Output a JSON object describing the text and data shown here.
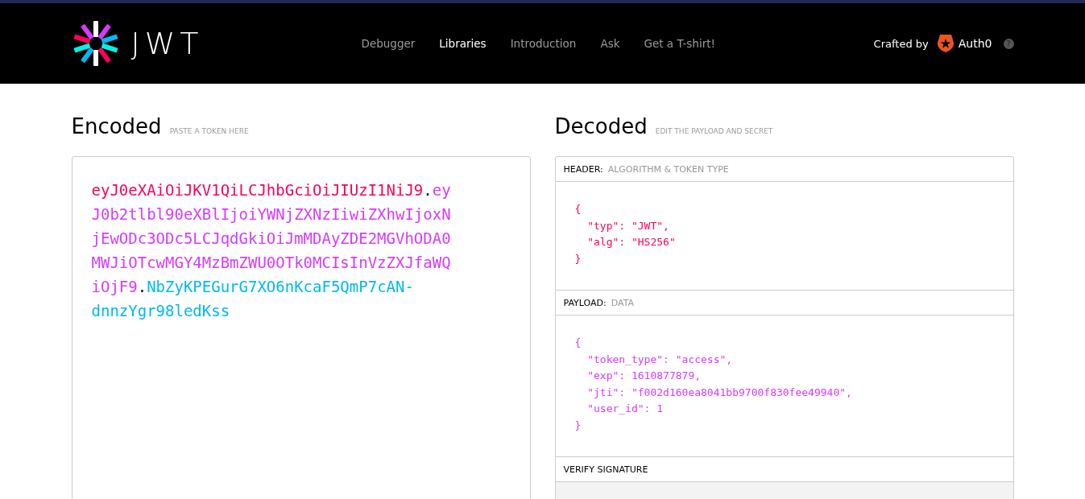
{
  "header": {
    "logo_text": "JWT",
    "nav": [
      {
        "label": "Debugger",
        "selected": false
      },
      {
        "label": "Libraries",
        "selected": true
      },
      {
        "label": "Introduction",
        "selected": false
      },
      {
        "label": "Ask",
        "selected": false
      },
      {
        "label": "Get a T-shirt!",
        "selected": false
      }
    ],
    "crafted_by": "Crafted by",
    "brand": "Auth0",
    "help": "?"
  },
  "encoded": {
    "title": "Encoded",
    "hint": "PASTE A TOKEN HERE",
    "parts": [
      {
        "kind": "header",
        "text": "eyJ0eXAiOiJKV1QiLCJhbGciOiJIUzI1NiJ9",
        "color": "#fb015b"
      },
      {
        "kind": "separator",
        "text": "."
      },
      {
        "kind": "payload",
        "text": "eyJ0b2tlbl90eXBlIjoiYWNjZXNzIiwiZXhwIjoxNjEwODc3ODc5LCJqdGkiOiJmMDAyZDE2MGVhODA0MWJiOTcwMGY4MzBmZWU0OTk0MCIsInVzZXJfaWQiOjF9",
        "color": "#d63aff"
      },
      {
        "kind": "separator",
        "text": "."
      },
      {
        "kind": "signature",
        "text": "NbZyKPEGurG7XO6nKcaF5QmP7cAN-dnnzYgr98ledKss",
        "color": "#00b9f1"
      }
    ]
  },
  "decoded": {
    "title": "Decoded",
    "hint": "EDIT THE PAYLOAD AND SECRET",
    "sections": [
      {
        "label": "HEADER:",
        "sublabel": "ALGORITHM & TOKEN TYPE",
        "color": "#fb015b",
        "lines": [
          "{",
          "  \"typ\": \"JWT\",",
          "  \"alg\": \"HS256\"",
          "}"
        ]
      },
      {
        "label": "PAYLOAD:",
        "sublabel": "DATA",
        "color": "#d63aff",
        "lines": [
          "{",
          "  \"token_type\": \"access\",",
          "  \"exp\": 1610877879,",
          "  \"jti\": \"f002d160ea8041bb9700f830fee49940\",",
          "  \"user_id\": 1",
          "}"
        ]
      },
      {
        "label": "VERIFY SIGNATURE"
      }
    ]
  }
}
